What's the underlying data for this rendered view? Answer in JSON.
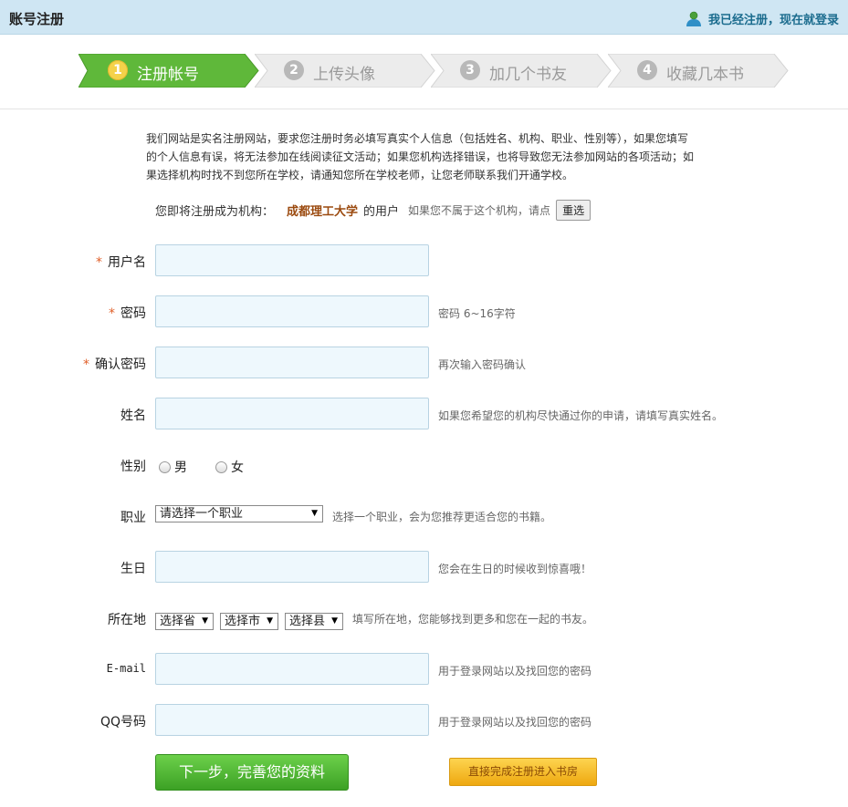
{
  "header": {
    "title": "账号注册",
    "login_link": "我已经注册，现在就登录",
    "login_icon": "user-icon"
  },
  "steps": [
    {
      "num": "1",
      "label": "注册帐号",
      "active": true
    },
    {
      "num": "2",
      "label": "上传头像",
      "active": false
    },
    {
      "num": "3",
      "label": "加几个书友",
      "active": false
    },
    {
      "num": "4",
      "label": "收藏几本书",
      "active": false
    }
  ],
  "intro": {
    "line1": "我们网站是实名注册网站，要求您注册时务必填写真实个人信息（包括姓名、机构、职业、性别等），如果您填写",
    "line2": "的个人信息有误，将无法参加在线阅读征文活动；如果您机构选择错误，也将导致您无法参加网站的各项活动；如",
    "line3": "果选择机构时找不到您所在学校，请通知您所在学校老师，让您老师联系我们开通学校。"
  },
  "org": {
    "prefix": "您即将注册成为机构：",
    "name": "成都理工大学",
    "suffix": "的用户",
    "hint": "如果您不属于这个机构，请点",
    "reselect": "重选"
  },
  "form": {
    "required_mark": "*",
    "username": {
      "label": "用户名"
    },
    "password": {
      "label": "密码",
      "tip": "密码 6~16字符"
    },
    "confirm": {
      "label": "确认密码",
      "tip": "再次输入密码确认"
    },
    "name": {
      "label": "姓名",
      "tip": "如果您希望您的机构尽快通过你的申请，请填写真实姓名。"
    },
    "gender": {
      "label": "性别",
      "male": "男",
      "female": "女"
    },
    "job": {
      "label": "职业",
      "selected": "请选择一个职业",
      "tip": "选择一个职业，会为您推荐更适合您的书籍。"
    },
    "birthday": {
      "label": "生日",
      "tip": "您会在生日的时候收到惊喜哦！"
    },
    "location": {
      "label": "所在地",
      "province": "选择省",
      "city": "选择市",
      "county": "选择县",
      "tip": "填写所在地，您能够找到更多和您在一起的书友。"
    },
    "email": {
      "label": "E-mail",
      "tip": "用于登录网站以及找回您的密码"
    },
    "qq": {
      "label": "QQ号码",
      "tip": "用于登录网站以及找回您的密码"
    }
  },
  "buttons": {
    "next": "下一步，完善您的资料",
    "finish": "直接完成注册进入书房"
  },
  "colors": {
    "header_bg": "#cfe6f3",
    "active_step": "#5fb83a",
    "inactive_step": "#ececec",
    "required": "#e0602a",
    "org_name": "#9b4a0f"
  }
}
